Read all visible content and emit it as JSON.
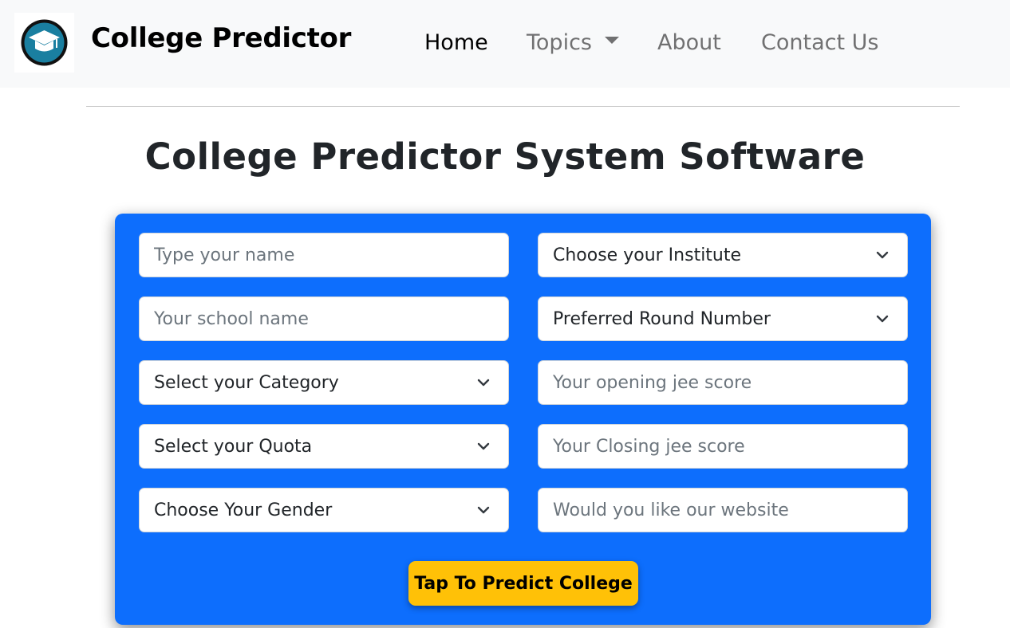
{
  "navbar": {
    "brand": "College Predictor",
    "logo_icon": "graduation-cap-icon",
    "links": {
      "home": "Home",
      "topics": "Topics",
      "about": "About",
      "contact": "Contact Us"
    }
  },
  "main": {
    "title": "College Predictor System Software"
  },
  "form": {
    "name_placeholder": "Type your name",
    "school_placeholder": "Your school name",
    "category_select": "Select your Category",
    "quota_select": "Select your Quota",
    "gender_select": "Choose Your Gender",
    "institute_select": "Choose your Institute",
    "round_select": "Preferred Round Number",
    "opening_placeholder": "Your opening jee score",
    "closing_placeholder": "Your Closing jee score",
    "website_placeholder": "Would you like our website",
    "submit_label": "Tap To Predict College"
  },
  "colors": {
    "panel": "#0d6efd",
    "button": "#ffc107",
    "logo_ring": "#1a7fa0"
  }
}
